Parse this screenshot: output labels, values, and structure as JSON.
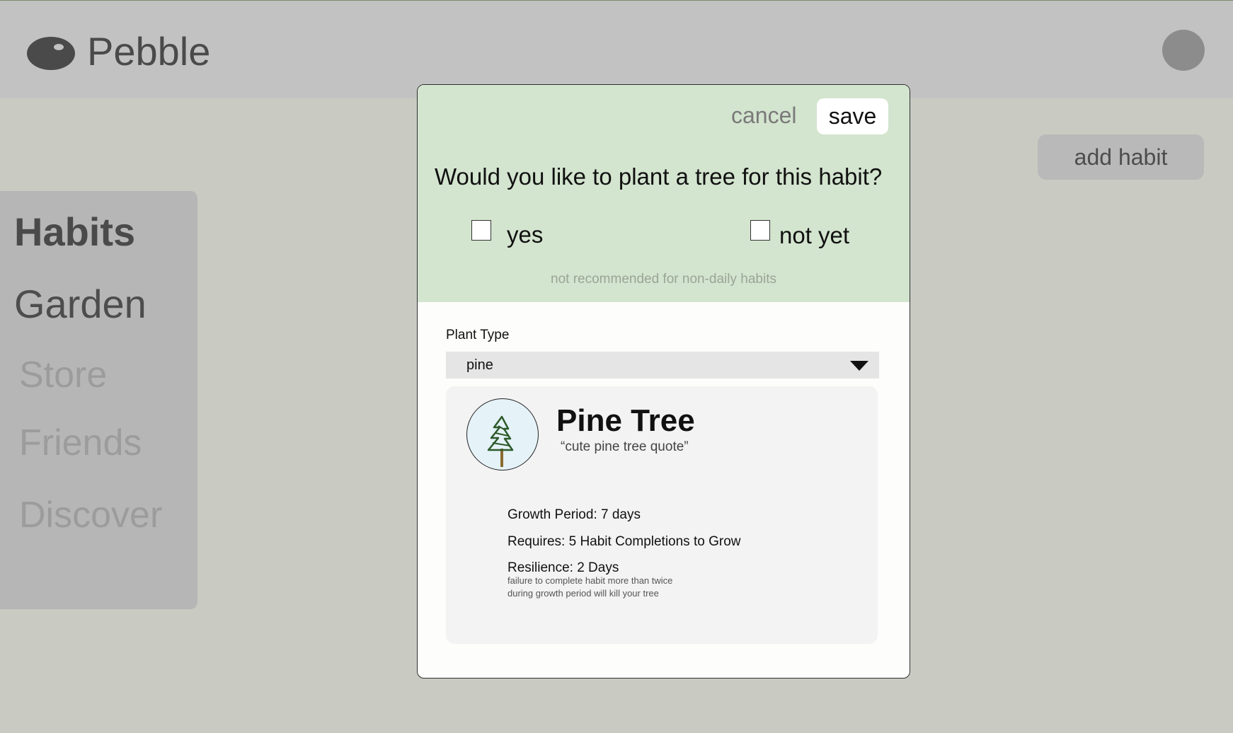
{
  "app": {
    "name": "Pebble",
    "logo_icon": "pebble-icon"
  },
  "header": {
    "add_habit_label": "add habit",
    "avatar_icon": "user-avatar"
  },
  "sidebar": {
    "items": [
      {
        "label": "Habits",
        "state": "active"
      },
      {
        "label": "Garden",
        "state": "normal"
      },
      {
        "label": "Store",
        "state": "disabled"
      },
      {
        "label": "Friends",
        "state": "disabled"
      },
      {
        "label": "Discover",
        "state": "disabled"
      }
    ]
  },
  "modal": {
    "cancel_label": "cancel",
    "save_label": "save",
    "question": "Would you like to plant a tree for this habit?",
    "options": [
      {
        "label": "yes",
        "checked": false
      },
      {
        "label": "not yet",
        "checked": false
      }
    ],
    "recommendation_note": "not recommended for non-daily habits",
    "plant_type_label": "Plant Type",
    "plant_type_selected": "pine",
    "plant": {
      "name": "Pine Tree",
      "quote": "“cute pine tree quote”",
      "icon": "pine-tree-icon",
      "growth_period": "Growth Period: 7 days",
      "requires": "Requires: 5 Habit Completions to Grow",
      "resilience": "Resilience: 2 Days",
      "resilience_note_line1": "failure to complete habit more than twice",
      "resilience_note_line2": "during growth period will kill your tree"
    }
  },
  "colors": {
    "background": "#c9cbc2",
    "modal_top": "#d3e4cf",
    "card": "#f3f3f3"
  }
}
